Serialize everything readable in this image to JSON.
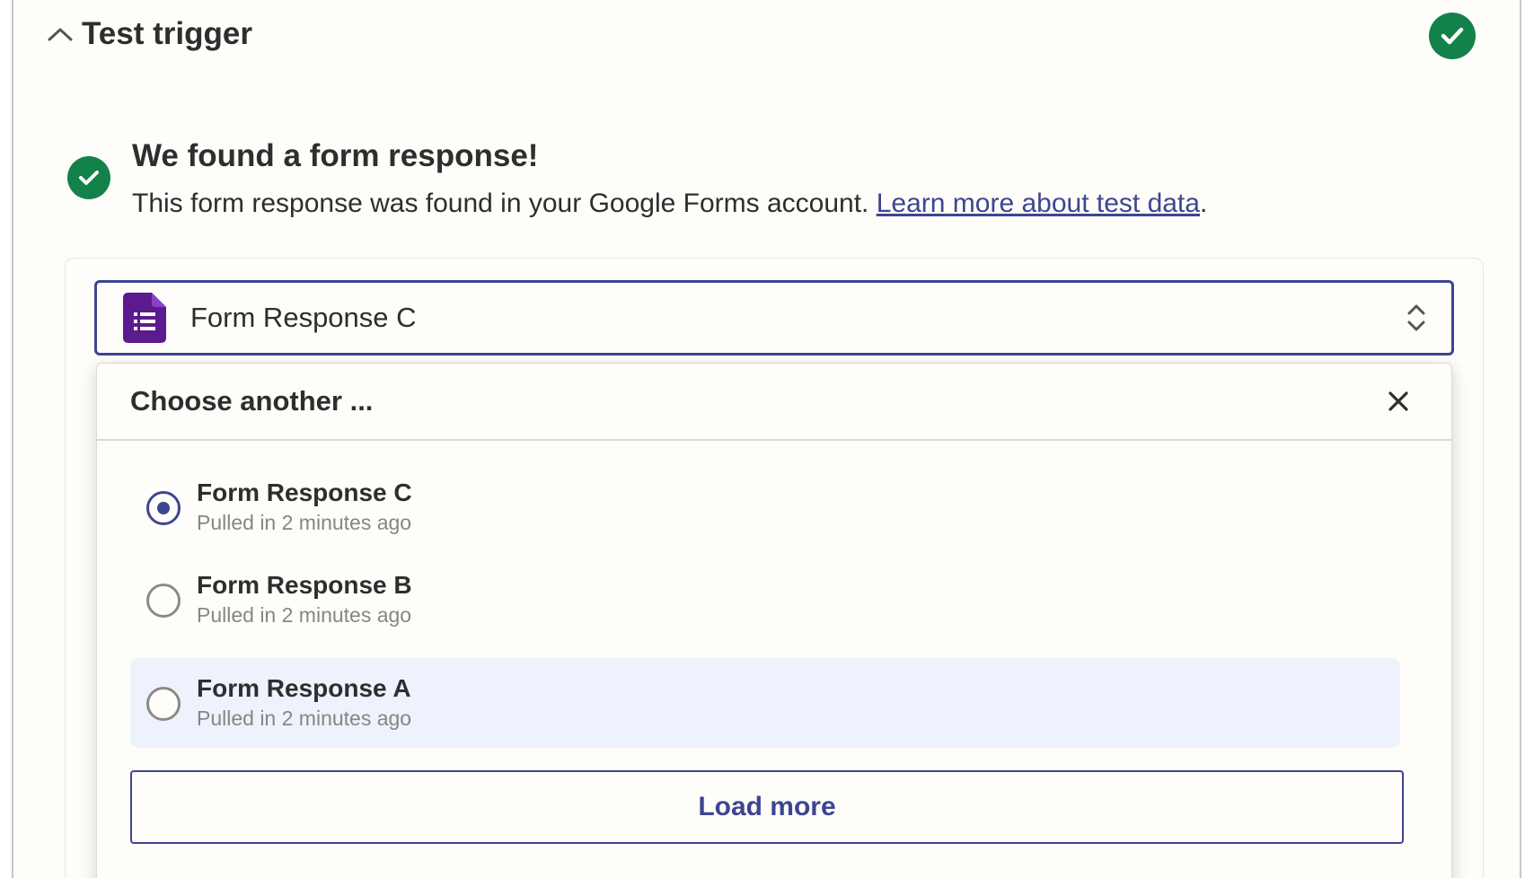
{
  "step": {
    "title": "Test trigger",
    "status": "complete"
  },
  "result": {
    "title": "We found a form response!",
    "description": "This form response was found in your Google Forms account. ",
    "link_text": "Learn more about test data",
    "trailing": "."
  },
  "selector": {
    "app_icon": "google-forms-icon",
    "selected_value": "Form Response C"
  },
  "dropdown": {
    "title": "Choose another ...",
    "options": [
      {
        "label": "Form Response C",
        "sub": "Pulled in 2 minutes ago",
        "selected": true
      },
      {
        "label": "Form Response B",
        "sub": "Pulled in 2 minutes ago",
        "selected": false
      },
      {
        "label": "Form Response A",
        "sub": "Pulled in 2 minutes ago",
        "selected": false
      }
    ],
    "load_more_label": "Load more"
  },
  "colors": {
    "success": "#13824a",
    "accent": "#3d4592",
    "forms_purple": "#5b1a8e",
    "hover_bg": "#edf2fc"
  }
}
